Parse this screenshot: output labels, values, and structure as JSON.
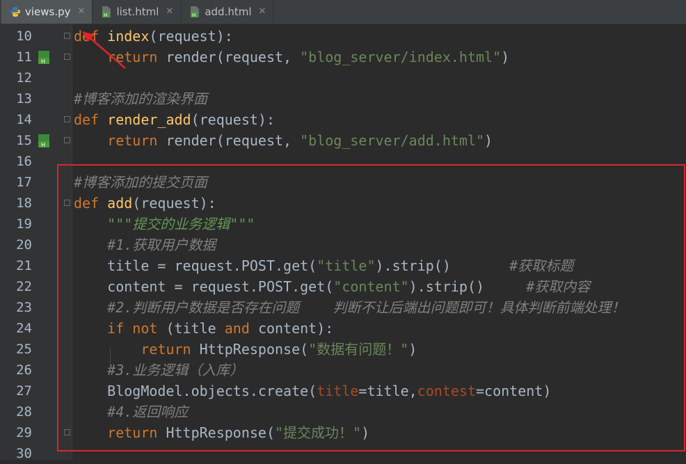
{
  "tabs": [
    {
      "label": "views.py",
      "icon": "python-file-icon",
      "active": true
    },
    {
      "label": "list.html",
      "icon": "html-file-icon",
      "active": false
    },
    {
      "label": "add.html",
      "icon": "html-file-icon",
      "active": false
    }
  ],
  "close_glyph": "✕",
  "gutter_badge": "H",
  "lines": [
    {
      "n": "10",
      "segs": [
        [
          "kw",
          "def "
        ],
        [
          "fn",
          "index"
        ],
        [
          "",
          "("
        ],
        [
          "",
          "request"
        ],
        [
          "",
          "):"
        ]
      ]
    },
    {
      "n": "11",
      "segs": [
        [
          "",
          "    "
        ],
        [
          "kw",
          "return "
        ],
        [
          "",
          "render(request, "
        ],
        [
          "str",
          "\"blog_server/index.html\""
        ],
        [
          "",
          ")"
        ]
      ]
    },
    {
      "n": "12",
      "segs": []
    },
    {
      "n": "13",
      "segs": [
        [
          "cm",
          "#博客添加的渲染界面"
        ]
      ]
    },
    {
      "n": "14",
      "segs": [
        [
          "kw",
          "def "
        ],
        [
          "fn",
          "render_add"
        ],
        [
          "",
          "(request):"
        ]
      ]
    },
    {
      "n": "15",
      "segs": [
        [
          "",
          "    "
        ],
        [
          "kw",
          "return "
        ],
        [
          "",
          "render(request, "
        ],
        [
          "str",
          "\"blog_server/add.html\""
        ],
        [
          "",
          ")"
        ]
      ]
    },
    {
      "n": "16",
      "segs": []
    },
    {
      "n": "17",
      "segs": [
        [
          "cm",
          "#博客添加的提交页面"
        ]
      ]
    },
    {
      "n": "18",
      "segs": [
        [
          "kw",
          "def "
        ],
        [
          "fn",
          "add"
        ],
        [
          "",
          "(request):"
        ]
      ]
    },
    {
      "n": "19",
      "segs": [
        [
          "",
          "    "
        ],
        [
          "doc",
          "\"\"\"提交的业务逻辑\"\"\""
        ]
      ]
    },
    {
      "n": "20",
      "segs": [
        [
          "",
          "    "
        ],
        [
          "cm",
          "#1.获取用户数据"
        ]
      ]
    },
    {
      "n": "21",
      "segs": [
        [
          "",
          "    title = request.POST.get("
        ],
        [
          "str",
          "\"title\""
        ],
        [
          "",
          ").strip()       "
        ],
        [
          "cm",
          "#获取标题"
        ]
      ]
    },
    {
      "n": "22",
      "segs": [
        [
          "",
          "    content = request.POST.get("
        ],
        [
          "str",
          "\"content\""
        ],
        [
          "",
          ").strip()     "
        ],
        [
          "cm",
          "#获取内容"
        ]
      ]
    },
    {
      "n": "23",
      "segs": [
        [
          "",
          "    "
        ],
        [
          "cm",
          "#2.判断用户数据是否存在问题    判断不让后端出问题即可！具体判断前端处理！"
        ]
      ]
    },
    {
      "n": "24",
      "segs": [
        [
          "",
          "    "
        ],
        [
          "kw",
          "if not "
        ],
        [
          "",
          "(title "
        ],
        [
          "kw",
          "and "
        ],
        [
          "",
          "content):"
        ]
      ]
    },
    {
      "n": "25",
      "segs": [
        [
          "",
          "        "
        ],
        [
          "kw",
          "return "
        ],
        [
          "",
          "HttpResponse("
        ],
        [
          "str",
          "\"数据有问题！\""
        ],
        [
          "",
          ")"
        ]
      ]
    },
    {
      "n": "26",
      "segs": [
        [
          "",
          "    "
        ],
        [
          "cm",
          "#3.业务逻辑（入库）"
        ]
      ]
    },
    {
      "n": "27",
      "segs": [
        [
          "",
          "    BlogModel.objects.create("
        ],
        [
          "param",
          "title"
        ],
        [
          "",
          "=title,"
        ],
        [
          "param",
          "contest"
        ],
        [
          "",
          "=content)"
        ]
      ]
    },
    {
      "n": "28",
      "segs": [
        [
          "",
          "    "
        ],
        [
          "cm",
          "#4.返回响应"
        ]
      ]
    },
    {
      "n": "29",
      "segs": [
        [
          "",
          "    "
        ],
        [
          "kw",
          "return "
        ],
        [
          "",
          "HttpResponse("
        ],
        [
          "str",
          "\"提交成功！\""
        ],
        [
          "",
          ")"
        ]
      ]
    },
    {
      "n": "30",
      "segs": []
    }
  ],
  "colors": {
    "background": "#2b2b2b",
    "keyword": "#cc7832",
    "function": "#ffc66d",
    "string": "#6a8759",
    "comment": "#808080",
    "annotation_box": "#e0242a"
  }
}
